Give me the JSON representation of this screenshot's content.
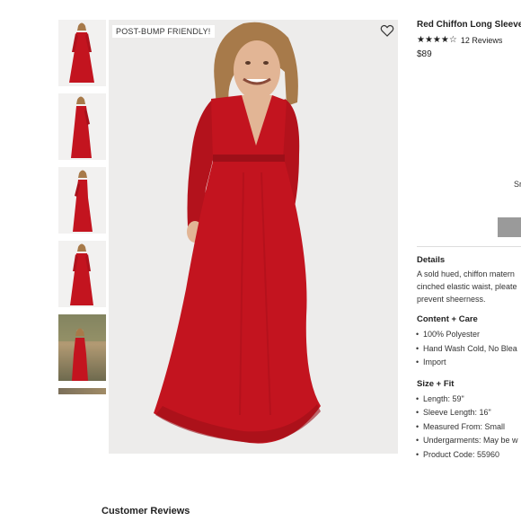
{
  "badge": "POST-BUMP FRIENDLY!",
  "product": {
    "title": "Red Chiffon Long Sleeve",
    "stars": "★★★★☆",
    "reviews": "12 Reviews",
    "price": "$89"
  },
  "size_partial": "Sr",
  "details": {
    "heading": "Details",
    "lines": [
      "A sold hued, chiffon matern",
      "cinched elastic waist, pleate",
      "prevent sheerness."
    ]
  },
  "content_care": {
    "heading": "Content + Care",
    "items": [
      "100% Polyester",
      "Hand Wash Cold, No Blea",
      "Import"
    ]
  },
  "size_fit": {
    "heading": "Size + Fit",
    "items": [
      "Length: 59\"",
      "Sleeve Length: 16\"",
      "Measured From: Small",
      "Undergarments: May be w",
      "Product Code: 55960"
    ]
  },
  "customer_reviews": "Customer Reviews",
  "colors": {
    "dress_red": "#c3141f",
    "dress_dark": "#9d0f18",
    "skin": "#e2b595",
    "hair": "#a77a4a"
  }
}
